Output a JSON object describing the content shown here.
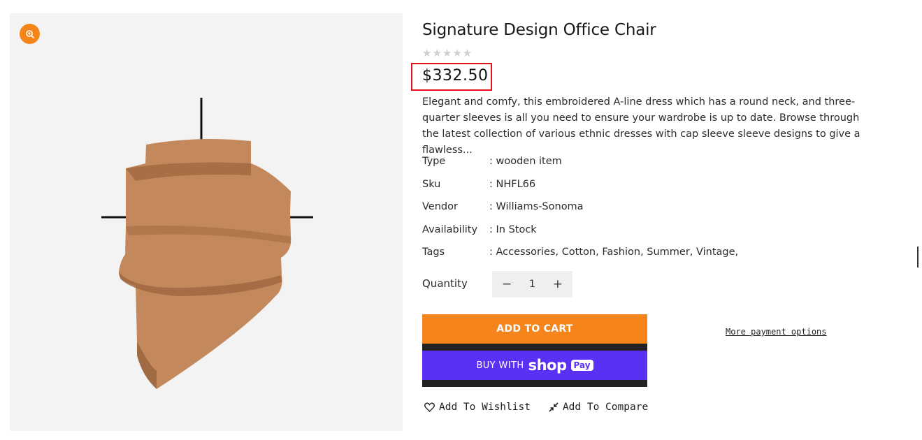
{
  "product": {
    "title": "Signature Design Office Chair",
    "rating_stars": "★★★★★",
    "price": "$332.50",
    "description": "Elegant and comfy, this embroidered A-line dress which has a round neck, and three-quarter sleeves is all you need to ensure your wardrobe is up to date. Browse through the latest collection of various ethnic dresses with cap sleeve sleeve designs to give a flawless...",
    "details": [
      {
        "label": "Type",
        "value": ": wooden item"
      },
      {
        "label": "Sku",
        "value": ": NHFL66"
      },
      {
        "label": "Vendor",
        "value": ": Williams-Sonoma"
      },
      {
        "label": "Availability",
        "value": ": In Stock"
      },
      {
        "label": "Tags",
        "value": ": Accessories, Cotton, Fashion, Summer, Vintage,"
      }
    ]
  },
  "quantity": {
    "label": "Quantity",
    "value": "1",
    "minus": "−",
    "plus": "+"
  },
  "buttons": {
    "add_to_cart": "ADD TO CART",
    "buy_with": "BUY WITH",
    "shop": "shop",
    "pay": "Pay",
    "more_payment": "More payment options",
    "wishlist": "Add To Wishlist",
    "compare": "Add To Compare"
  },
  "colors": {
    "accent": "#f58518",
    "shop_pay": "#5a31f4",
    "highlight_border": "#e0141a"
  },
  "icons": [
    "zoom-icon",
    "heart-icon",
    "compare-icon"
  ]
}
